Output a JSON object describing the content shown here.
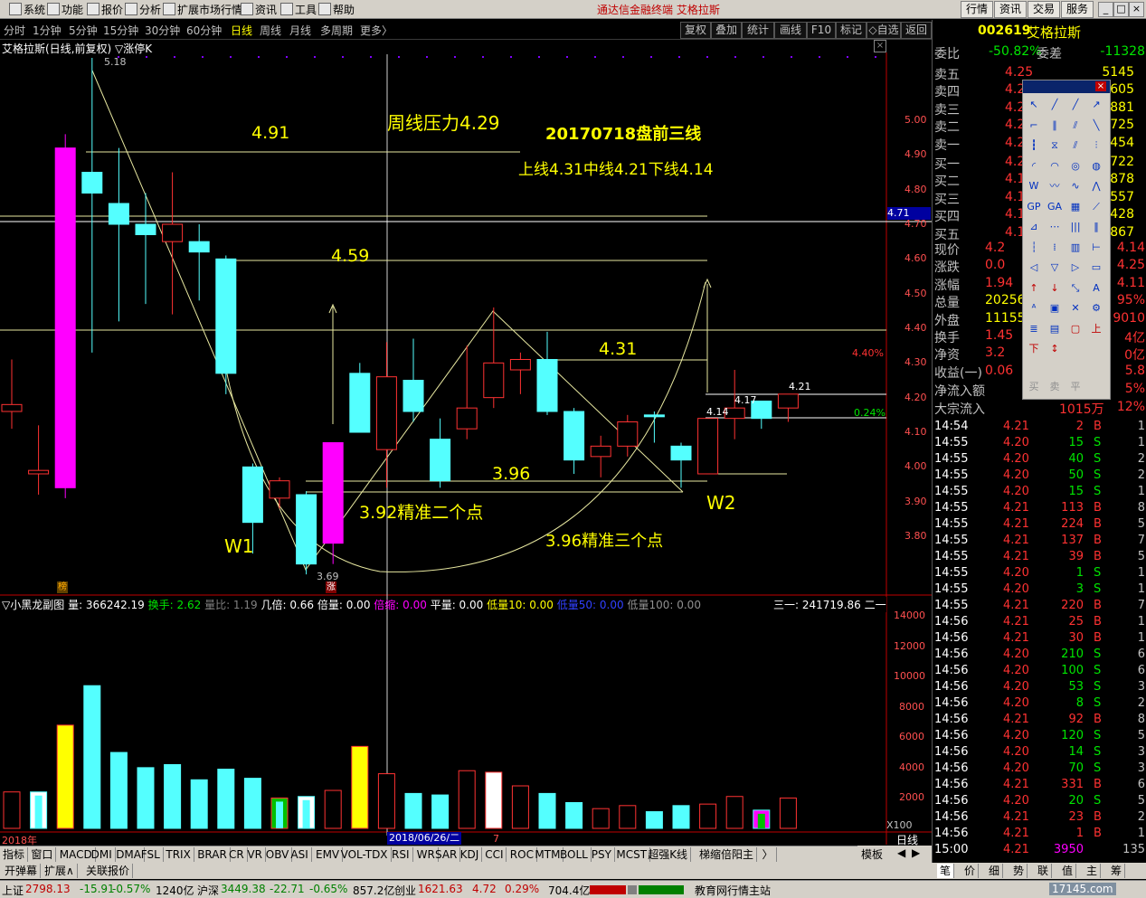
{
  "menu": {
    "items": [
      "系统",
      "功能",
      "报价",
      "分析",
      "扩展市场行情",
      "资讯",
      "工具",
      "帮助"
    ],
    "app_title": "通达信金融终端  艾格拉斯",
    "right_buttons": [
      "行情",
      "资讯",
      "交易",
      "服务"
    ]
  },
  "period_bar": {
    "items": [
      "分时",
      "1分钟",
      "5分钟",
      "15分钟",
      "30分钟",
      "60分钟",
      "日线",
      "周线",
      "月线",
      "多周期",
      "更多〉"
    ],
    "active": "日线",
    "tools": [
      "复权",
      "叠加",
      "统计",
      "画线",
      "F10",
      "标记",
      "◇自选",
      "返回"
    ]
  },
  "chart_header": {
    "title": "艾格拉斯(日线,前复权)",
    "indicator": "▽涨停K",
    "high_label": "5.18",
    "low_label": "3.69"
  },
  "annotations": {
    "weekly_pressure": "周线压力4.29",
    "premarket_lines": "20170718盘前三线",
    "three_lines": "上线4.31中线4.21下线4.14",
    "level_491": "4.91",
    "level_459": "4.59",
    "level_431": "4.31",
    "level_396": "3.96",
    "two_points": "3.92精准二个点",
    "three_points": "3.96精准三个点",
    "w1": "W1",
    "w2": "W2",
    "price_414": "4.14",
    "price_417": "4.17",
    "price_421": "4.21",
    "pct_440": "4.40%",
    "pct_024": "0.24%",
    "current_price_tag": "4.71",
    "bang": "榜",
    "zhang": "涨"
  },
  "price_axis": [
    "5.00",
    "4.90",
    "4.80",
    "4.70",
    "4.60",
    "4.50",
    "4.40",
    "4.30",
    "4.20",
    "4.10",
    "4.00",
    "3.90",
    "3.80"
  ],
  "volume_header": {
    "name": "▽小黑龙副图",
    "volume": "量: 366242.19",
    "turnover": "换手: 2.62",
    "vol_ratio": "量比: 1.19",
    "ji_bei": "几倍: 0.66",
    "bei_liang": "倍量: 0.00",
    "bei_suo": "倍缩: 0.00",
    "ping_liang": "平量: 0.00",
    "low_vol10": "低量10: 0.00",
    "low_vol50": "低量50: 0.00",
    "low_vol100": "低量100: 0.00",
    "right_value": "三一: 241719.86",
    "right_more": "二一"
  },
  "volume_axis": [
    "14000",
    "12000",
    "10000",
    "8000",
    "6000",
    "4000",
    "2000"
  ],
  "volume_unit": "X100",
  "date_axis": {
    "year": "2018年",
    "cursor_date": "2018/06/26/二",
    "cursor_suffix": "7",
    "period_label": "日线"
  },
  "chart_data": {
    "type": "candlestick",
    "candles": [
      {
        "o": 4.18,
        "h": 4.31,
        "l": 4.11,
        "c": 4.16,
        "color": "up"
      },
      {
        "o": 3.98,
        "h": 4.12,
        "l": 3.92,
        "c": 3.99,
        "color": "up"
      },
      {
        "o": 3.94,
        "h": 4.96,
        "l": 3.91,
        "c": 4.92,
        "color": "limit"
      },
      {
        "o": 4.85,
        "h": 5.18,
        "l": 4.33,
        "c": 4.79,
        "color": "down"
      },
      {
        "o": 4.76,
        "h": 4.92,
        "l": 4.42,
        "c": 4.7,
        "color": "down"
      },
      {
        "o": 4.7,
        "h": 4.79,
        "l": 4.47,
        "c": 4.67,
        "color": "down"
      },
      {
        "o": 4.65,
        "h": 4.85,
        "l": 4.44,
        "c": 4.7,
        "color": "up"
      },
      {
        "o": 4.65,
        "h": 4.7,
        "l": 4.48,
        "c": 4.62,
        "color": "down"
      },
      {
        "o": 4.6,
        "h": 4.61,
        "l": 4.21,
        "c": 4.27,
        "color": "down"
      },
      {
        "o": 4.0,
        "h": 4.01,
        "l": 3.75,
        "c": 3.84,
        "color": "down"
      },
      {
        "o": 3.96,
        "h": 3.97,
        "l": 3.88,
        "c": 3.91,
        "color": "up"
      },
      {
        "o": 3.92,
        "h": 3.93,
        "l": 3.69,
        "c": 3.72,
        "color": "down"
      },
      {
        "o": 3.78,
        "h": 4.04,
        "l": 3.72,
        "c": 4.07,
        "color": "limit"
      },
      {
        "o": 4.27,
        "h": 4.3,
        "l": 4.1,
        "c": 4.1,
        "color": "down"
      },
      {
        "o": 4.05,
        "h": 4.36,
        "l": 3.94,
        "c": 4.26,
        "color": "up"
      },
      {
        "o": 4.25,
        "h": 4.37,
        "l": 4.13,
        "c": 4.16,
        "color": "down"
      },
      {
        "o": 4.08,
        "h": 4.14,
        "l": 3.94,
        "c": 3.96,
        "color": "down"
      },
      {
        "o": 4.11,
        "h": 4.35,
        "l": 4.08,
        "c": 4.17,
        "color": "up"
      },
      {
        "o": 4.2,
        "h": 4.46,
        "l": 4.17,
        "c": 4.3,
        "color": "up"
      },
      {
        "o": 4.28,
        "h": 4.33,
        "l": 4.21,
        "c": 4.31,
        "color": "up"
      },
      {
        "o": 4.31,
        "h": 4.39,
        "l": 4.15,
        "c": 4.16,
        "color": "down"
      },
      {
        "o": 4.16,
        "h": 4.17,
        "l": 3.98,
        "c": 4.02,
        "color": "down"
      },
      {
        "o": 4.03,
        "h": 4.09,
        "l": 3.97,
        "c": 4.06,
        "color": "up"
      },
      {
        "o": 4.06,
        "h": 4.15,
        "l": 4.03,
        "c": 4.13,
        "color": "up"
      },
      {
        "o": 4.15,
        "h": 4.16,
        "l": 4.07,
        "c": 4.15,
        "color": "down"
      },
      {
        "o": 4.06,
        "h": 4.07,
        "l": 3.94,
        "c": 4.02,
        "color": "down"
      },
      {
        "o": 3.98,
        "h": 4.14,
        "l": 3.98,
        "c": 4.14,
        "color": "up"
      },
      {
        "o": 4.14,
        "h": 4.28,
        "l": 4.08,
        "c": 4.17,
        "color": "up"
      },
      {
        "o": 4.14,
        "h": 4.19,
        "l": 4.11,
        "c": 4.19,
        "color": "down"
      },
      {
        "o": 4.17,
        "h": 4.21,
        "l": 4.13,
        "c": 4.21,
        "color": "up"
      }
    ],
    "volumes": [
      {
        "v": 2400,
        "color": "up"
      },
      {
        "v": 2400,
        "color": "down_white"
      },
      {
        "v": 6800,
        "color": "limit"
      },
      {
        "v": 9400,
        "color": "down"
      },
      {
        "v": 5000,
        "color": "down"
      },
      {
        "v": 4000,
        "color": "down"
      },
      {
        "v": 4200,
        "color": "down"
      },
      {
        "v": 3200,
        "color": "down"
      },
      {
        "v": 3900,
        "color": "down"
      },
      {
        "v": 3300,
        "color": "down"
      },
      {
        "v": 2000,
        "color": "up_green"
      },
      {
        "v": 2100,
        "color": "down_white"
      },
      {
        "v": 2500,
        "color": "up"
      },
      {
        "v": 5400,
        "color": "limit"
      },
      {
        "v": 3600,
        "color": "up"
      },
      {
        "v": 2300,
        "color": "down"
      },
      {
        "v": 2200,
        "color": "down"
      },
      {
        "v": 3800,
        "color": "up"
      },
      {
        "v": 3700,
        "color": "up_white"
      },
      {
        "v": 2800,
        "color": "up"
      },
      {
        "v": 2300,
        "color": "down"
      },
      {
        "v": 1700,
        "color": "down"
      },
      {
        "v": 1300,
        "color": "up"
      },
      {
        "v": 1500,
        "color": "up"
      },
      {
        "v": 1100,
        "color": "down"
      },
      {
        "v": 1500,
        "color": "down"
      },
      {
        "v": 1600,
        "color": "up"
      },
      {
        "v": 2100,
        "color": "up"
      },
      {
        "v": 1200,
        "color": "down_mixed"
      },
      {
        "v": 2000,
        "color": "up"
      }
    ],
    "price_range": [
      3.69,
      5.18
    ],
    "volume_max": 14000
  },
  "quote": {
    "code": "002619",
    "name": "艾格拉斯",
    "wei_bi_label": "委比",
    "wei_bi": "-50.82%",
    "wei_cha_label": "委差",
    "wei_cha": "-11328",
    "asks": [
      {
        "label": "卖五",
        "price": "4.25",
        "vol": "5145"
      },
      {
        "label": "卖四",
        "price": "4.2",
        "vol": "605"
      },
      {
        "label": "卖三",
        "price": "4.2",
        "vol": "881"
      },
      {
        "label": "卖二",
        "price": "4.2",
        "vol": "725"
      },
      {
        "label": "卖一",
        "price": "4.2",
        "vol": "454"
      }
    ],
    "bids": [
      {
        "label": "买一",
        "price": "4.2",
        "vol": "722"
      },
      {
        "label": "买二",
        "price": "4.1",
        "vol": "878"
      },
      {
        "label": "买三",
        "price": "4.1",
        "vol": "557"
      },
      {
        "label": "买四",
        "price": "4.1",
        "vol": "428"
      },
      {
        "label": "买五",
        "price": "4.1",
        "vol": "867"
      }
    ],
    "stats": [
      {
        "label": "现价",
        "value": "4.2",
        "right": "4.14"
      },
      {
        "label": "涨跌",
        "value": "0.0",
        "right": "4.25"
      },
      {
        "label": "涨幅",
        "value": "1.94",
        "right": "4.11"
      },
      {
        "label": "总量",
        "value": "20256",
        "right": "95%"
      },
      {
        "label": "外盘",
        "value": "11155",
        "right": "9010"
      },
      {
        "label": "换手",
        "value": "1.45",
        "right": "4亿"
      },
      {
        "label": "净资",
        "value": "3.2",
        "right": "0亿"
      },
      {
        "label": "收益(一)",
        "value": "0.06",
        "right": "5.8"
      }
    ],
    "net_inflow_label": "净流入额",
    "net_inflow": "5%",
    "block_label": "大宗流入",
    "block_value": "1015万",
    "block_pct": "12%"
  },
  "ticks": [
    {
      "t": "14:54",
      "p": "4.21",
      "v": "2",
      "s": "B",
      "n": "1"
    },
    {
      "t": "14:55",
      "p": "4.20",
      "v": "15",
      "s": "S",
      "n": "1"
    },
    {
      "t": "14:55",
      "p": "4.20",
      "v": "40",
      "s": "S",
      "n": "2"
    },
    {
      "t": "14:55",
      "p": "4.20",
      "v": "50",
      "s": "S",
      "n": "2"
    },
    {
      "t": "14:55",
      "p": "4.20",
      "v": "15",
      "s": "S",
      "n": "1"
    },
    {
      "t": "14:55",
      "p": "4.21",
      "v": "113",
      "s": "B",
      "n": "8"
    },
    {
      "t": "14:55",
      "p": "4.21",
      "v": "224",
      "s": "B",
      "n": "5"
    },
    {
      "t": "14:55",
      "p": "4.21",
      "v": "137",
      "s": "B",
      "n": "7"
    },
    {
      "t": "14:55",
      "p": "4.21",
      "v": "39",
      "s": "B",
      "n": "5"
    },
    {
      "t": "14:55",
      "p": "4.20",
      "v": "1",
      "s": "S",
      "n": "1"
    },
    {
      "t": "14:55",
      "p": "4.20",
      "v": "3",
      "s": "S",
      "n": "1"
    },
    {
      "t": "14:55",
      "p": "4.21",
      "v": "220",
      "s": "B",
      "n": "7"
    },
    {
      "t": "14:56",
      "p": "4.21",
      "v": "25",
      "s": "B",
      "n": "1"
    },
    {
      "t": "14:56",
      "p": "4.21",
      "v": "30",
      "s": "B",
      "n": "1"
    },
    {
      "t": "14:56",
      "p": "4.20",
      "v": "210",
      "s": "S",
      "n": "6"
    },
    {
      "t": "14:56",
      "p": "4.20",
      "v": "100",
      "s": "S",
      "n": "6"
    },
    {
      "t": "14:56",
      "p": "4.20",
      "v": "53",
      "s": "S",
      "n": "3"
    },
    {
      "t": "14:56",
      "p": "4.20",
      "v": "8",
      "s": "S",
      "n": "2"
    },
    {
      "t": "14:56",
      "p": "4.21",
      "v": "92",
      "s": "B",
      "n": "8"
    },
    {
      "t": "14:56",
      "p": "4.20",
      "v": "120",
      "s": "S",
      "n": "5"
    },
    {
      "t": "14:56",
      "p": "4.20",
      "v": "14",
      "s": "S",
      "n": "3"
    },
    {
      "t": "14:56",
      "p": "4.20",
      "v": "70",
      "s": "S",
      "n": "3"
    },
    {
      "t": "14:56",
      "p": "4.21",
      "v": "331",
      "s": "B",
      "n": "6"
    },
    {
      "t": "14:56",
      "p": "4.20",
      "v": "20",
      "s": "S",
      "n": "5"
    },
    {
      "t": "14:56",
      "p": "4.21",
      "v": "23",
      "s": "B",
      "n": "2"
    },
    {
      "t": "14:56",
      "p": "4.21",
      "v": "1",
      "s": "B",
      "n": "1"
    },
    {
      "t": "15:00",
      "p": "4.21",
      "v": "3950",
      "s": "",
      "n": "135"
    }
  ],
  "indicator_tabs": [
    "指标",
    "窗口",
    "MACD",
    "DMI",
    "DMA",
    "FSL",
    "TRIX",
    "BRAR",
    "CR",
    "VR",
    "OBV",
    "ASI",
    "EMV",
    "VOL-TDX",
    "RSI",
    "WR",
    "SAR",
    "KDJ",
    "CCI",
    "ROC",
    "MTM",
    "BOLL",
    "PSY",
    "MCST",
    "超强K线",
    "梯缩倍阳主",
    "〉"
  ],
  "template_label": "模板",
  "bottom_tabs": [
    "开弹幕",
    "扩展∧",
    "关联报价"
  ],
  "right_bottom_tabs": [
    "笔",
    "价",
    "细",
    "势",
    "联",
    "值",
    "主",
    "筹"
  ],
  "status": {
    "sh_label": "上证",
    "sh": "2798.13",
    "sh_chg": "-15.91",
    "sh_pct": "-0.57%",
    "sh_amt": "1240亿",
    "sz_label": "沪深",
    "sz": "3449.38",
    "sz_chg": "-22.71",
    "sz_pct": "-0.65%",
    "sz_amt": "857.2亿",
    "cy_label": "创业",
    "cy": "1621.63",
    "cy_chg": "4.72",
    "cy_pct": "0.29%",
    "cy_amt": "704.4亿",
    "site": "教育网行情主站",
    "watermark": "17145.com"
  },
  "palette_icons": [
    "cursor-icon",
    "line-icon",
    "ray-icon",
    "arrow-ray-icon",
    "segment-icon",
    "parallel-icon",
    "channel-icon",
    "slash-icon",
    "vertical-line-icon",
    "fib-icon",
    "parallel-lines-icon",
    "multi-lines-icon",
    "arc-icon",
    "circle-arc-icon",
    "circle-icon",
    "sphere-icon",
    "wave-icon",
    "zigzag-icon",
    "trend-icon",
    "w-pattern-icon",
    "gp-icon",
    "ga-icon",
    "grid-icon",
    "fan-icon",
    "gann-icon",
    "cycle-icon",
    "bars-icon",
    "wave-bars-icon",
    "fib-bars-icon",
    "cycle-bars-icon",
    "dense-bars-icon",
    "measure-icon",
    "box-icon",
    "triangle-icon",
    "flag-icon",
    "rect-icon",
    "up-arrow-icon",
    "down-arrow-icon",
    "swing-icon",
    "text-icon",
    "text-a-icon",
    "copy-icon",
    "delete-icon",
    "settings-icon",
    "list-icon",
    "save-icon",
    "image-icon",
    "up-mark-icon",
    "down-mark-icon",
    "flat-mark-icon"
  ],
  "palette_text": [
    "买",
    "卖",
    "平"
  ]
}
